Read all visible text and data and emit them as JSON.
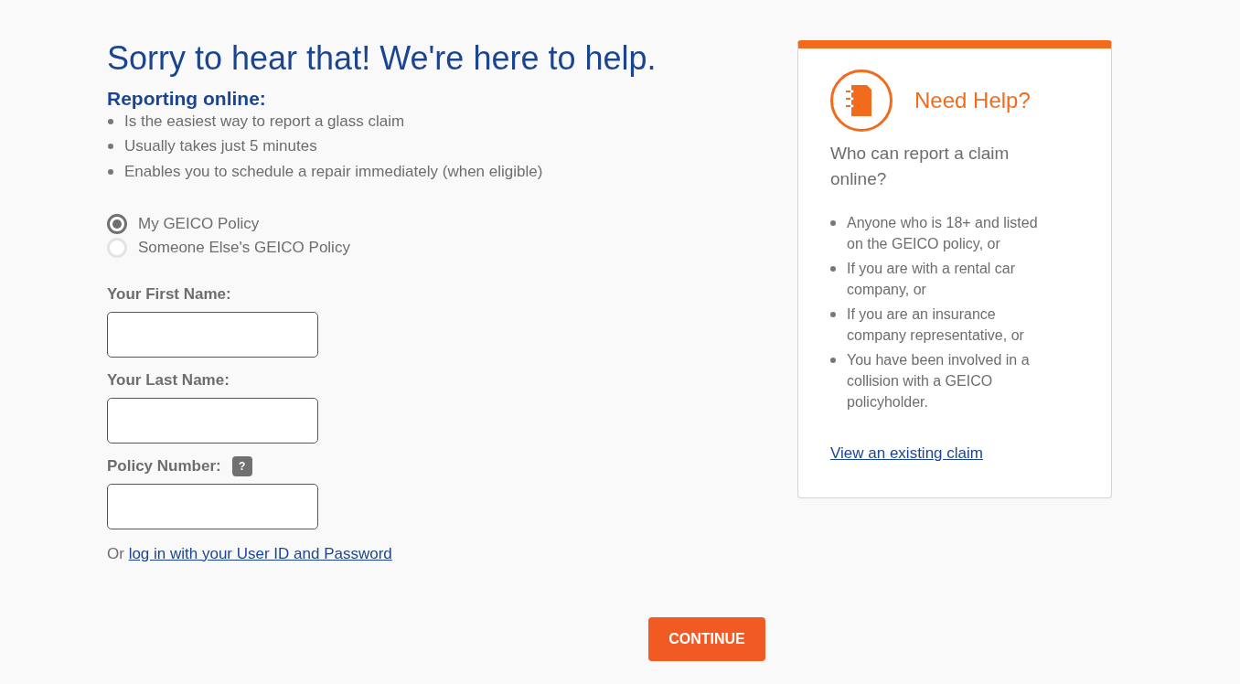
{
  "heading": "Sorry to hear that! We're here to help.",
  "reporting": {
    "title": "Reporting online:",
    "bullets": [
      "Is the easiest way to report a glass claim",
      "Usually takes just 5 minutes",
      "Enables you to schedule a repair immediately (when eligible)"
    ]
  },
  "policy_options": [
    {
      "label": "My GEICO Policy",
      "selected": true
    },
    {
      "label": "Someone Else's GEICO Policy",
      "selected": false
    }
  ],
  "fields": [
    {
      "label": "Your First Name:"
    },
    {
      "label": "Your Last Name:"
    },
    {
      "label": "Policy Number:",
      "help": "?"
    }
  ],
  "login_prompt": {
    "prefix": "Or",
    "link": "log in with your User ID and Password"
  },
  "help_card": {
    "title": "Need Help?",
    "question": "Who can report a claim online?",
    "bullets": [
      "Anyone who is 18+ and listed on the GEICO policy, or",
      "If you are with a rental car company, or",
      "If you are an insurance company representative, or",
      "You have been involved in a collision with a GEICO policyholder."
    ],
    "link": "View an existing claim"
  },
  "continue_button": "CONTINUE"
}
